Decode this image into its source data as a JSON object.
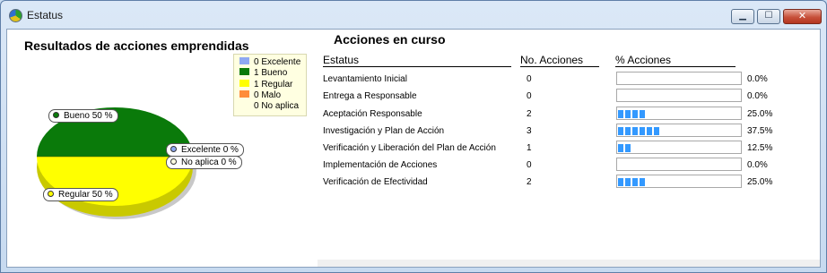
{
  "window": {
    "title": "Estatus"
  },
  "window_controls": {
    "minimize": "▁",
    "maximize": "☐",
    "close": "✕"
  },
  "pie": {
    "title": "Resultados de acciones emprendidas",
    "legend": [
      {
        "label": "0 Excelente",
        "color": "#8ea8f2"
      },
      {
        "label": "1 Bueno",
        "color": "#0a7a0a"
      },
      {
        "label": "1 Regular",
        "color": "#ffff00"
      },
      {
        "label": "0 Malo",
        "color": "#ff8c3a"
      },
      {
        "label": "0 No aplica",
        "color": "#ffffe1"
      }
    ],
    "labels": {
      "bueno": "Bueno 50 %",
      "excelente": "Excelente 0 %",
      "no_aplica": "No aplica 0 %",
      "regular": "Regular 50 %"
    }
  },
  "chart_data": {
    "type": "pie",
    "categories": [
      "Excelente",
      "Bueno",
      "Regular",
      "Malo",
      "No aplica"
    ],
    "values": [
      0,
      1,
      1,
      0,
      0
    ],
    "percent": [
      0,
      50,
      50,
      0,
      0
    ],
    "title": "Resultados de acciones emprendidas",
    "colors": [
      "#8ea8f2",
      "#0a7a0a",
      "#ffff00",
      "#ff8c3a",
      "#ffffe1"
    ]
  },
  "actions": {
    "title": "Acciones en curso",
    "headers": {
      "status": "Estatus",
      "count": "No. Acciones",
      "percent": "% Acciones"
    },
    "rows": [
      {
        "status": "Levantamiento Inicial",
        "count": "0",
        "percent": "0.0%",
        "fraction": 0.0
      },
      {
        "status": "Entrega a Responsable",
        "count": "0",
        "percent": "0.0%",
        "fraction": 0.0
      },
      {
        "status": "Aceptación Responsable",
        "count": "2",
        "percent": "25.0%",
        "fraction": 0.25
      },
      {
        "status": "Investigación y Plan de Acción",
        "count": "3",
        "percent": "37.5%",
        "fraction": 0.375
      },
      {
        "status": "Verificación y Liberación del Plan de Acción",
        "count": "1",
        "percent": "12.5%",
        "fraction": 0.125
      },
      {
        "status": "Implementación de Acciones",
        "count": "0",
        "percent": "0.0%",
        "fraction": 0.0
      },
      {
        "status": "Verificación de Efectividad",
        "count": "2",
        "percent": "25.0%",
        "fraction": 0.25
      }
    ]
  }
}
